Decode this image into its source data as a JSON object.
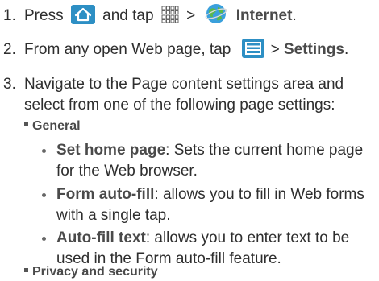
{
  "step1": {
    "number": "1.",
    "press": "Press",
    "and_tap": "and tap",
    "separator": ">",
    "internet": "Internet",
    "period": "."
  },
  "step2": {
    "number": "2.",
    "text": "From any open Web page, tap",
    "separator": ">",
    "settings": "Settings",
    "period": "."
  },
  "step3": {
    "number": "3.",
    "text": "Navigate to the Page content settings area and select from one of the following page settings:"
  },
  "sections": [
    {
      "title": "General",
      "items": [
        {
          "label": "Set home page",
          "desc": ": Sets the current home page for the Web browser."
        },
        {
          "label": "Form auto-fill",
          "desc": ": allows you to fill in Web forms with a single tap."
        },
        {
          "label": "Auto-fill text",
          "desc": ": allows you to enter text to be used in the Form auto-fill feature."
        }
      ]
    },
    {
      "title": "Privacy and security",
      "items": []
    }
  ],
  "icons": {
    "home": "home-icon",
    "apps": "apps-grid-icon",
    "internet": "globe-icon",
    "menu": "menu-icon"
  },
  "colors": {
    "icon_blue": "#2d8fc4",
    "text": "#2e2e2e"
  }
}
